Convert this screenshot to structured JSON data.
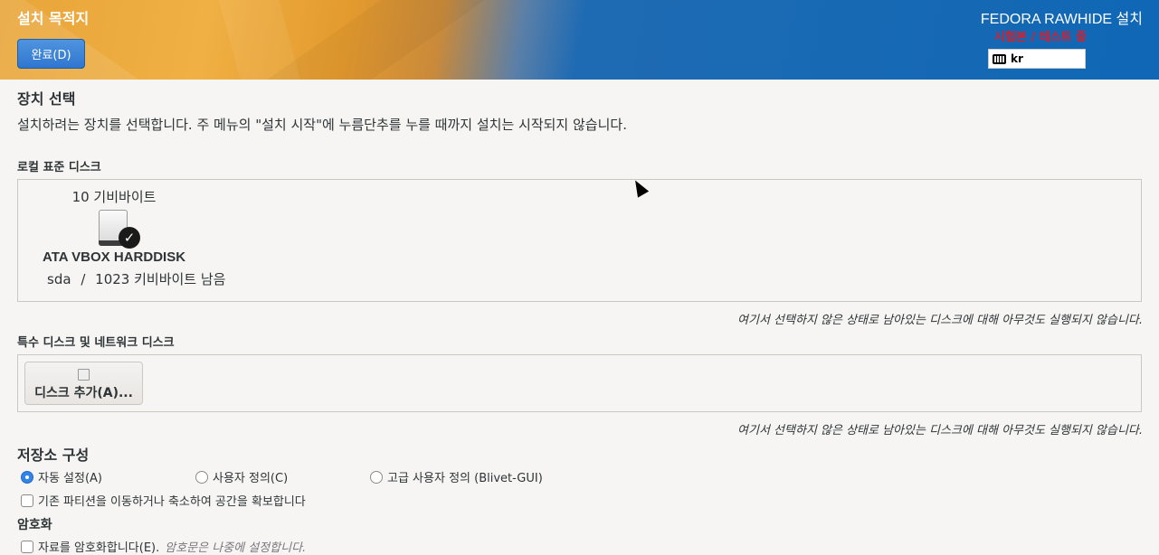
{
  "header": {
    "spoke_title": "설치 목적지",
    "done_label": "완료(D)",
    "product_title": "FEDORA RAWHIDE 설치",
    "prerelease": "시험본 / 테스트 중",
    "keyboard_layout": "kr"
  },
  "device_selection": {
    "heading": "장치 선택",
    "description": "설치하려는 장치를 선택합니다. 주 메뉴의 \"설치 시작\"에 누름단추를 누를 때까지 설치는 시작되지 않습니다."
  },
  "local_disks": {
    "label": "로컬 표준 디스크",
    "disks": [
      {
        "size": "10 기비바이트",
        "name": "ATA VBOX HARDDISK",
        "device": "sda",
        "separator": "/",
        "free": "1023 키비바이트 남음",
        "selected": true
      }
    ],
    "note": "여기서 선택하지 않은 상태로 남아있는 디스크에 대해 아무것도 실행되지 않습니다."
  },
  "special_disks": {
    "label": "특수 디스크 및 네트워크 디스크",
    "add_button": "디스크 추가(A)...",
    "note": "여기서 선택하지 않은 상태로 남아있는 디스크에 대해 아무것도 실행되지 않습니다."
  },
  "storage_config": {
    "heading": "저장소 구성",
    "options": [
      {
        "label": "자동 설정(A)",
        "selected": true
      },
      {
        "label": "사용자 정의(C)",
        "selected": false
      },
      {
        "label": "고급 사용자 정의 (Blivet-GUI)",
        "selected": false
      }
    ],
    "reclaim_label": "기존 파티션을 이동하거나 축소하여 공간을 확보합니다"
  },
  "encryption": {
    "heading": "암호화",
    "encrypt_label": "자료를 암호화합니다(E).",
    "encrypt_hint": "암호문은 나중에 설정합니다."
  },
  "colors": {
    "accent": "#3584e4",
    "prerelease": "#e01b24",
    "header_blue": "#0f67b5",
    "header_orange": "#f0b043"
  }
}
